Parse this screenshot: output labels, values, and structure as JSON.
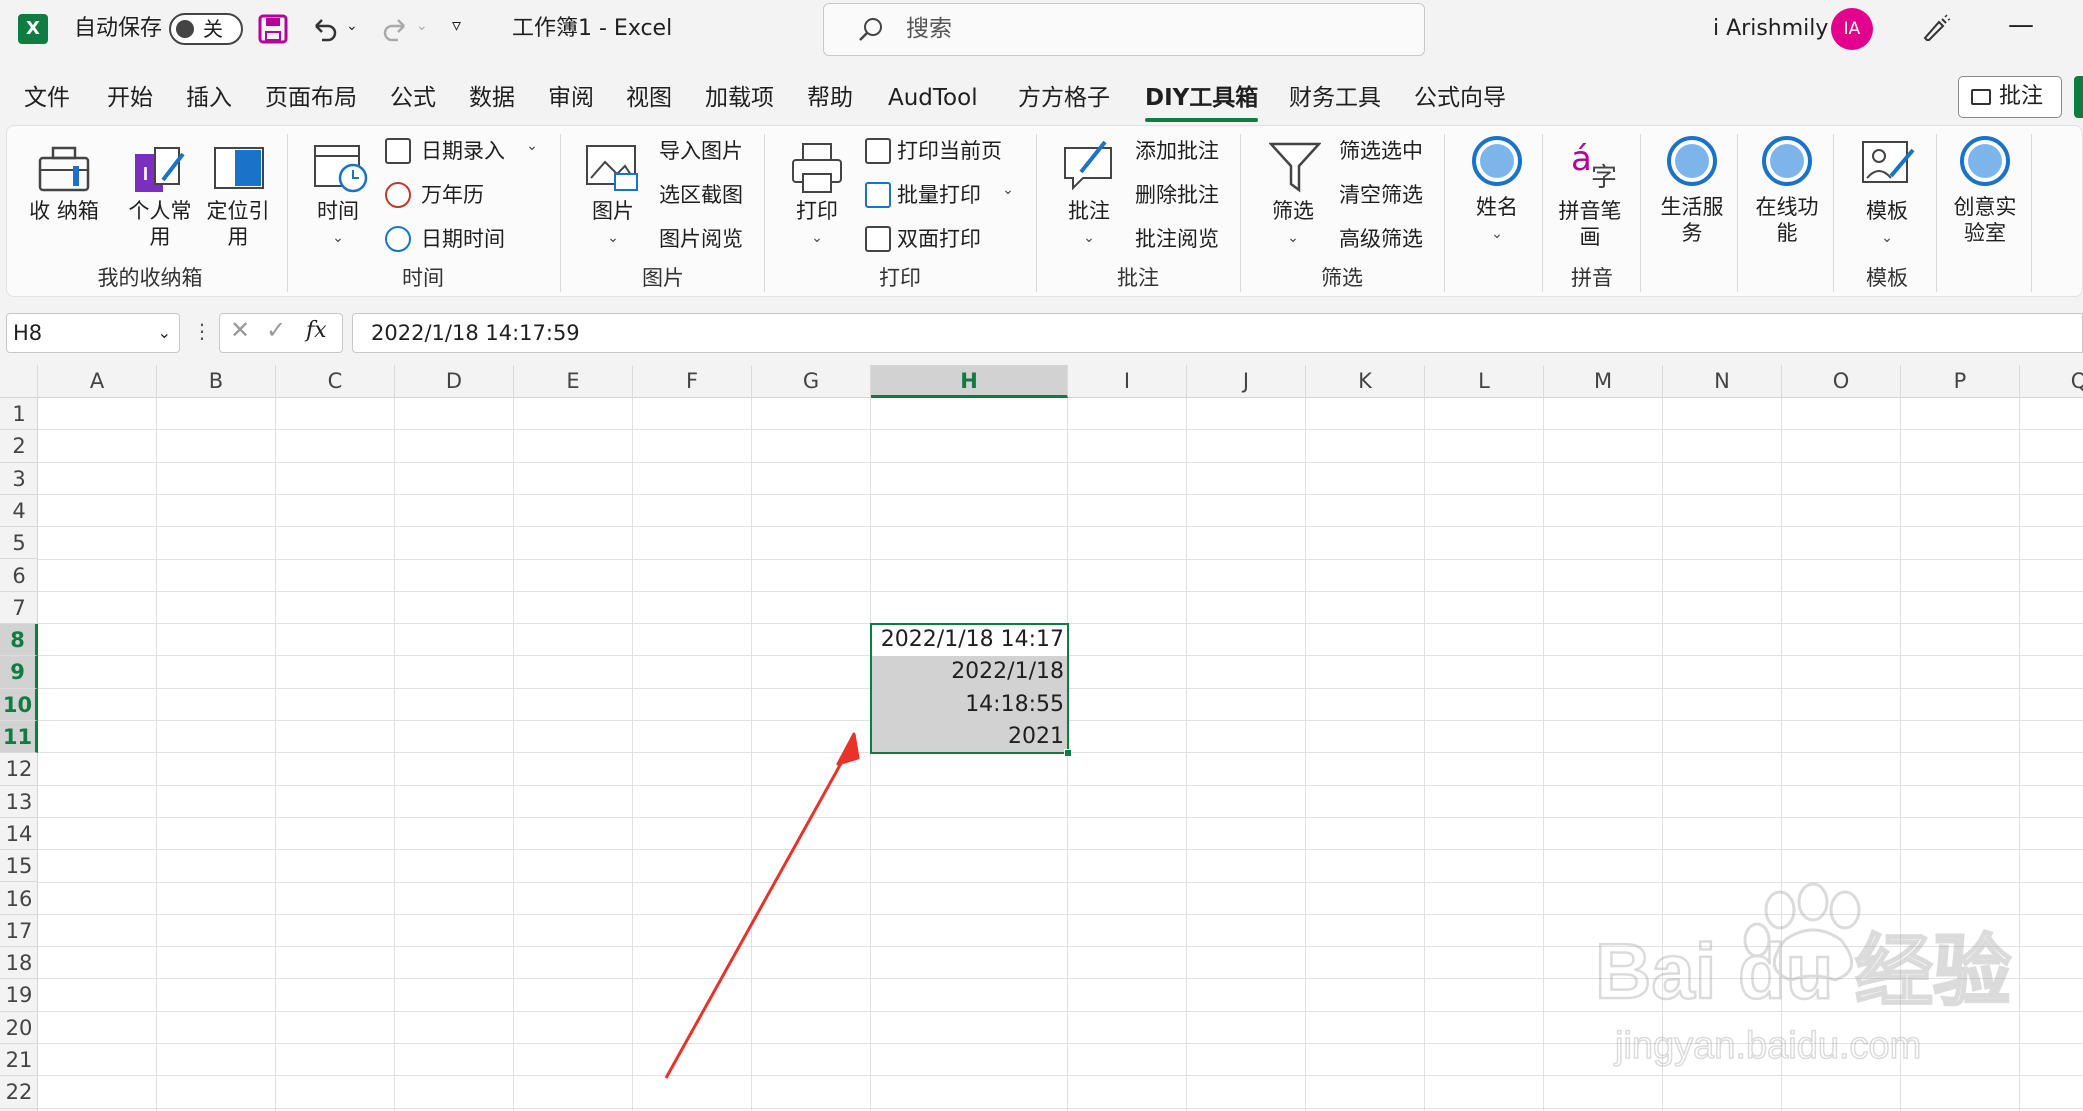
{
  "titlebar": {
    "autosave_label": "自动保存",
    "autosave_state": "关",
    "workbook_title": "工作簿1  -  Excel",
    "search_placeholder": "搜索",
    "user_name": "i Arishmily",
    "avatar_initials": "IA"
  },
  "tabs": [
    {
      "label": "文件"
    },
    {
      "label": "开始"
    },
    {
      "label": "插入"
    },
    {
      "label": "页面布局"
    },
    {
      "label": "公式"
    },
    {
      "label": "数据"
    },
    {
      "label": "审阅"
    },
    {
      "label": "视图"
    },
    {
      "label": "加载项"
    },
    {
      "label": "帮助"
    },
    {
      "label": "AudTool"
    },
    {
      "label": "方方格子"
    },
    {
      "label": "DIY工具箱",
      "active": true
    },
    {
      "label": "财务工具"
    },
    {
      "label": "公式向导"
    }
  ],
  "comment_button": "批注",
  "ribbon": {
    "groups": [
      {
        "label": "我的收纳箱",
        "buttons": [
          "收\n纳箱",
          "个人常\n用",
          "定位引\n用"
        ]
      },
      {
        "label": "时间",
        "buttons": [
          "时间"
        ],
        "small": [
          "日期录入",
          "万年历",
          "日期时间"
        ]
      },
      {
        "label": "图片",
        "buttons": [
          "图片"
        ],
        "small": [
          "导入图片",
          "选区截图",
          "图片阅览"
        ]
      },
      {
        "label": "打印",
        "buttons": [
          "打印"
        ],
        "small": [
          "打印当前页",
          "批量打印",
          "双面打印"
        ]
      },
      {
        "label": "批注",
        "buttons": [
          "批注"
        ],
        "small": [
          "添加批注",
          "删除批注",
          "批注阅览"
        ]
      },
      {
        "label": "筛选",
        "buttons": [
          "筛选"
        ],
        "small": [
          "筛选选中",
          "清空筛选",
          "高级筛选"
        ]
      },
      {
        "label": "",
        "buttons": [
          "姓名"
        ]
      },
      {
        "label": "拼音",
        "buttons": [
          "拼音笔\n画"
        ]
      },
      {
        "label": "",
        "buttons": [
          "生活服\n务"
        ]
      },
      {
        "label": "",
        "buttons": [
          "在线功\n能"
        ]
      },
      {
        "label": "模板",
        "buttons": [
          "模板"
        ]
      },
      {
        "label": "",
        "buttons": [
          "创意实\n验室"
        ]
      }
    ]
  },
  "formula_bar": {
    "name_box": "H8",
    "fx": "fx",
    "formula": "2022/1/18  14:17:59"
  },
  "grid": {
    "columns": [
      "A",
      "B",
      "C",
      "D",
      "E",
      "F",
      "G",
      "H",
      "I",
      "J",
      "K",
      "L",
      "M",
      "N",
      "O",
      "P",
      "Q"
    ],
    "rows": [
      "1",
      "2",
      "3",
      "4",
      "5",
      "6",
      "7",
      "8",
      "9",
      "10",
      "11",
      "12",
      "13",
      "14",
      "15",
      "16",
      "17",
      "18",
      "19",
      "20",
      "21",
      "22"
    ],
    "selected_column": "H",
    "selected_rows": [
      "8",
      "9",
      "10",
      "11"
    ],
    "cells": {
      "H8": "2022/1/18 14:17",
      "H9": "2022/1/18",
      "H10": "14:18:55",
      "H11": "2021"
    }
  },
  "watermark": {
    "brand": "Bai du 经验",
    "url": "jingyan.baidu.com"
  },
  "colors": {
    "excel_green": "#107c41",
    "selection_fill": "#d2d2d2",
    "arrow": "#e8322a",
    "avatar": "#e3008c"
  }
}
